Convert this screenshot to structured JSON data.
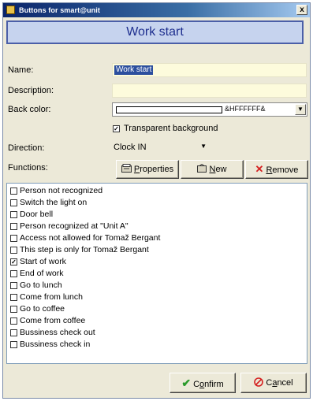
{
  "window": {
    "title": "Buttons for smart@unit",
    "close_glyph": "x"
  },
  "header": {
    "title": "Work start"
  },
  "form": {
    "name_label": "Name:",
    "name_value": "Work start",
    "description_label": "Description:",
    "description_value": "",
    "back_color_label": "Back color:",
    "back_color_value": "&HFFFFFF&",
    "back_color_swatch": "#ffffff",
    "transparent_label": "Transparent background",
    "transparent_checked": true,
    "direction_label": "Direction:",
    "direction_value": "Clock IN",
    "functions_label": "Functions:"
  },
  "toolbar": {
    "properties_prefix": "",
    "properties_mnemonic": "P",
    "properties_rest": "roperties",
    "new_mnemonic": "N",
    "new_rest": "ew",
    "remove_mnemonic": "R",
    "remove_rest": "emove"
  },
  "functions": [
    {
      "label": "Person not recognized",
      "checked": false
    },
    {
      "label": "Switch the light on",
      "checked": false
    },
    {
      "label": "Door bell",
      "checked": false
    },
    {
      "label": "Person recognized at \"Unit A\"",
      "checked": false
    },
    {
      "label": "Access not allowed for Tomaž Bergant",
      "checked": false
    },
    {
      "label": "This step is only for Tomaž Bergant",
      "checked": false
    },
    {
      "label": "Start of work",
      "checked": true
    },
    {
      "label": "End of work",
      "checked": false
    },
    {
      "label": "Go to lunch",
      "checked": false
    },
    {
      "label": "Come from lunch",
      "checked": false
    },
    {
      "label": "Go to coffee",
      "checked": false
    },
    {
      "label": "Come from coffee",
      "checked": false
    },
    {
      "label": "Bussiness check out",
      "checked": false
    },
    {
      "label": "Bussiness check in",
      "checked": false
    }
  ],
  "footer": {
    "confirm_pre": "C",
    "confirm_mnemonic": "o",
    "confirm_rest": "nfirm",
    "cancel_pre": "C",
    "cancel_mnemonic": "a",
    "cancel_rest": "ncel"
  },
  "colors": {
    "banner_bg": "#c6d3ee",
    "banner_text": "#1e2f8f",
    "confirm_icon": "#2a9a2a",
    "cancel_icon": "#d42020",
    "remove_icon": "#d42020"
  },
  "icons": [
    "app-icon",
    "close-icon",
    "properties-icon",
    "new-icon",
    "remove-icon",
    "checkmark-icon",
    "cancel-icon",
    "dropdown-arrow-icon"
  ]
}
